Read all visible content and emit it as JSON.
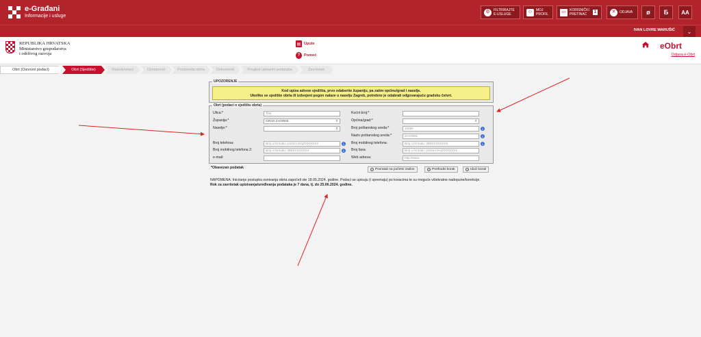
{
  "topbar": {
    "brand_title": "e-Građani",
    "brand_subtitle": "Informacije i usluge",
    "buttons": [
      {
        "line1": "FILTRIRAJTE",
        "line2": "E-USLUGE"
      },
      {
        "line1": "MOJ",
        "line2": "PROFIL"
      },
      {
        "line1": "KORISNIČKI",
        "line2": "PRETINAC",
        "badge": "1"
      },
      {
        "line1": "ODJAVA",
        "line2": ""
      }
    ],
    "hide_icon": "ø",
    "latin_toggle": "Б",
    "font_size": "AA"
  },
  "userbar": {
    "user_name": "IVAN LOVRE MARUŠIĆ",
    "dropdown_glyph": "⌄"
  },
  "header": {
    "ministry_line1": "REPUBLIKA HRVATSKA",
    "ministry_line2": "Ministarstvo gospodarstva",
    "ministry_line3": "i održivog razvoja",
    "upute_label": "Upute",
    "pomoc_label": "Pomoć",
    "app_name": "eObrt",
    "logout_label": "Odjava e-Obrt"
  },
  "steps": [
    "Obrt (Osnovni podaci)",
    "Obrt (Sjedište)",
    "Vlasnik/ortaci",
    "Djelatnosti",
    "Poslovođa obrta",
    "Dokumenti",
    "Pregled upisanih podataka",
    "Završetak"
  ],
  "warning": {
    "legend": "UPOZORENJE",
    "line1": "Kod upisa adrese sjedišta, prvo odaberite županiju, pa zatim općinu/grad i naselje.",
    "line2": "Ukoliko se sjedište obrta ili izdvojeni pogon nalaze u naselju Zagreb, potrebno je odabrati odgovarajuću gradsku četvrt."
  },
  "form": {
    "legend": "Obrt (podaci o sjedištu obrta)",
    "left": [
      {
        "label": "Ulica:*",
        "value": "Test"
      },
      {
        "label": "Županija:*",
        "value": "GRAD ZAGREB"
      },
      {
        "label": "Naselje:*",
        "value": ""
      },
      {
        "label": "Broj telefona:",
        "value": "Broj u formatu: pozivni broj/XXXXXXX"
      },
      {
        "label": "Broj mobilnog telefona 2:",
        "value": "Broj u formatu: 385XXXXXXXX"
      },
      {
        "label": "e-mail:",
        "value": ""
      }
    ],
    "right": [
      {
        "label": "Kućni broj:*",
        "value": ""
      },
      {
        "label": "Općina/grad:*",
        "value": ""
      },
      {
        "label": "Broj poštanskog ureda:*",
        "value": "10000"
      },
      {
        "label": "Naziv poštanskog ureda:*",
        "value": "ZAGREB"
      },
      {
        "label": "Broj mobilnog telefona:",
        "value": "Broj u formatu: 385XXXXXXXX"
      },
      {
        "label": "Broj faxa:",
        "value": "Broj u formatu: pozivni broj/XXXXXXX"
      },
      {
        "label": "Web adresa:",
        "value": "http://www."
      }
    ],
    "select_arrow": "⇕",
    "info_glyph": "i"
  },
  "footer": {
    "required_note": "*Obavezan podatak",
    "btn_home": "Povratak na početni zaslon",
    "btn_prev": "Prethodni korak",
    "btn_next": "Idući korak",
    "note_part1": "NAPOMENA: Iniciranje postupka osnivanja obrta započeli ste 18.05.2024. godine. Podaci se upisuju (i spremaju) po koracima te su moguće višekratne nadopune/korekcije. ",
    "note_part2": "Rok za završetak upisivanja/uređivanja podataka je 7 dana, tj. do 25.06.2024. godine."
  },
  "colors": {
    "brand_red": "#b3232b",
    "active_step": "#c8102e",
    "warning_yellow": "#f6f08a",
    "annotation_arrow": "#e02020"
  }
}
